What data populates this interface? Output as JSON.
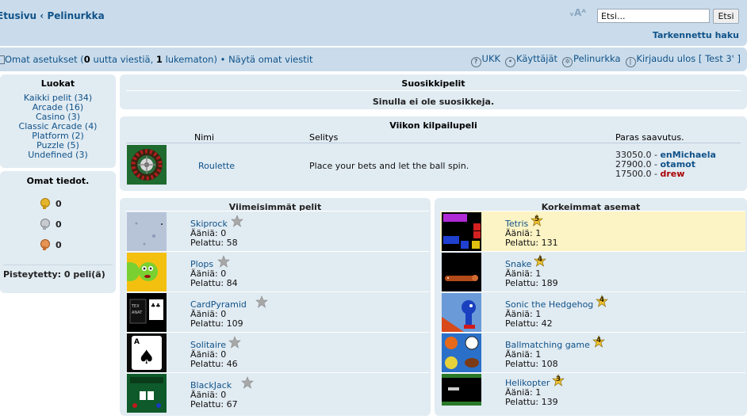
{
  "header": {
    "breadcrumb_home": "Etusivu",
    "breadcrumb_sep": "‹",
    "breadcrumb_current": "Pelinurkka",
    "fontsize_label": "ᵥAᴬ",
    "search_value": "Etsi...",
    "search_button": "Etsi",
    "advanced_search": "Tarkennettu haku"
  },
  "navbar": {
    "settings": "Omat asetukset",
    "new_count": "0",
    "new_label": "uutta viestiä,",
    "unread_count": "1",
    "unread_label": "lukematon)",
    "open_paren": " (",
    "bullet": "•",
    "own_posts": "Näytä omat viestit",
    "faq": "UKK",
    "users": "Käyttäjät",
    "arcade": "Pelinurkka",
    "logout": "Kirjaudu ulos [ Test 3' ]"
  },
  "categories": {
    "title": "Luokat",
    "items": [
      {
        "label": "Kaikki pelit (34)"
      },
      {
        "label": "Arcade (16)"
      },
      {
        "label": "Casino (3)"
      },
      {
        "label": "Classic Arcade (4)"
      },
      {
        "label": "Platform (2)"
      },
      {
        "label": "Puzzle (5)"
      },
      {
        "label": "Undefined (3)"
      }
    ]
  },
  "my_info": {
    "title": "Omat tiedot.",
    "gold": "0",
    "silver": "0",
    "bronze": "0",
    "rated": "Pisteytetty: 0 peli(ä)"
  },
  "favorites": {
    "title": "Suosikkipelit",
    "message": "Sinulla ei ole suosikkeja."
  },
  "weekly": {
    "title": "Viikon kilpailupeli",
    "col_name": "Nimi",
    "col_desc": "Selitys",
    "col_best": "Paras saavutus.",
    "game": "Roulette",
    "description": "Place your bets and let the ball spin.",
    "scores": [
      {
        "score": "33050.0 - ",
        "user": "enMichaela"
      },
      {
        "score": "27900.0 - ",
        "user": "otamot"
      },
      {
        "score": "17500.0 - ",
        "user": "drew"
      }
    ]
  },
  "recent": {
    "title": "Viimeisimmät pelit",
    "games": [
      {
        "name": "Skiprock",
        "votes": "Ääniä: 0",
        "played": "Pelattu: 58"
      },
      {
        "name": "Plops",
        "votes": "Ääniä: 0",
        "played": "Pelattu: 84"
      },
      {
        "name": "CardPyramid",
        "votes": "Ääniä: 0",
        "played": "Pelattu: 109"
      },
      {
        "name": "Solitaire",
        "votes": "Ääniä: 0",
        "played": "Pelattu: 46"
      },
      {
        "name": "BlackJack",
        "votes": "Ääniä: 0",
        "played": "Pelattu: 67"
      }
    ]
  },
  "top": {
    "title": "Korkeimmat asemat",
    "games": [
      {
        "name": "Tetris",
        "rank": "5",
        "votes": "Ääniä: 1",
        "played": "Pelattu: 131"
      },
      {
        "name": "Snake",
        "rank": "4",
        "votes": "Ääniä: 1",
        "played": "Pelattu: 189"
      },
      {
        "name": "Sonic the Hedgehog",
        "rank": "4",
        "votes": "Ääniä: 1",
        "played": "Pelattu: 42"
      },
      {
        "name": "Ballmatching game",
        "rank": "4",
        "votes": "Ääniä: 1",
        "played": "Pelattu: 108"
      },
      {
        "name": "Helikopter",
        "rank": "3",
        "votes": "Ääniä: 1",
        "played": "Pelattu: 139"
      }
    ]
  },
  "colors": {
    "header_bg": "#cadceb",
    "panel_bg": "#e1ebf2",
    "link": "#105289",
    "highlight_row": "#fcf4c4"
  }
}
